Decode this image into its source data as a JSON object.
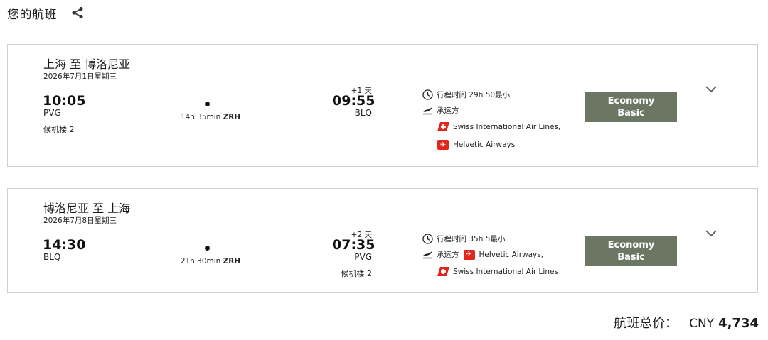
{
  "header": {
    "title": "您的航班"
  },
  "flights": [
    {
      "route": "上海 至 博洛尼亚",
      "date": "2026年7月1日星期三",
      "departure": {
        "time": "10:05",
        "code": "PVG",
        "terminal": "候机楼 2"
      },
      "arrival": {
        "time": "09:55",
        "code": "BLQ",
        "plus_day": "+1 天",
        "terminal": ""
      },
      "stop_duration": "14h 35min",
      "stop_code": "ZRH",
      "travel_time": "行程时间 29h 50最小",
      "carrier_label": "承运方",
      "airlines": [
        "Swiss International Air Lines,",
        "Helvetic Airways"
      ],
      "fare": {
        "line1": "Economy",
        "line2": "Basic"
      }
    },
    {
      "route": "博洛尼亚 至 上海",
      "date": "2026年7月8日星期三",
      "departure": {
        "time": "14:30",
        "code": "BLQ",
        "terminal": ""
      },
      "arrival": {
        "time": "07:35",
        "code": "PVG",
        "plus_day": "+2 天",
        "terminal": "候机楼 2"
      },
      "stop_duration": "21h 30min",
      "stop_code": "ZRH",
      "travel_time": "行程时间 35h 5最小",
      "carrier_label": "承运方",
      "airlines": [
        "Helvetic Airways,",
        "Swiss International Air Lines"
      ],
      "fare": {
        "line1": "Economy",
        "line2": "Basic"
      }
    }
  ],
  "total": {
    "label": "航班总价：",
    "currency": "CNY",
    "amount": "4,734"
  },
  "colors": {
    "fare_badge": "#6b7663",
    "airline_red": "#e1261c",
    "border": "#cfcfcf"
  }
}
